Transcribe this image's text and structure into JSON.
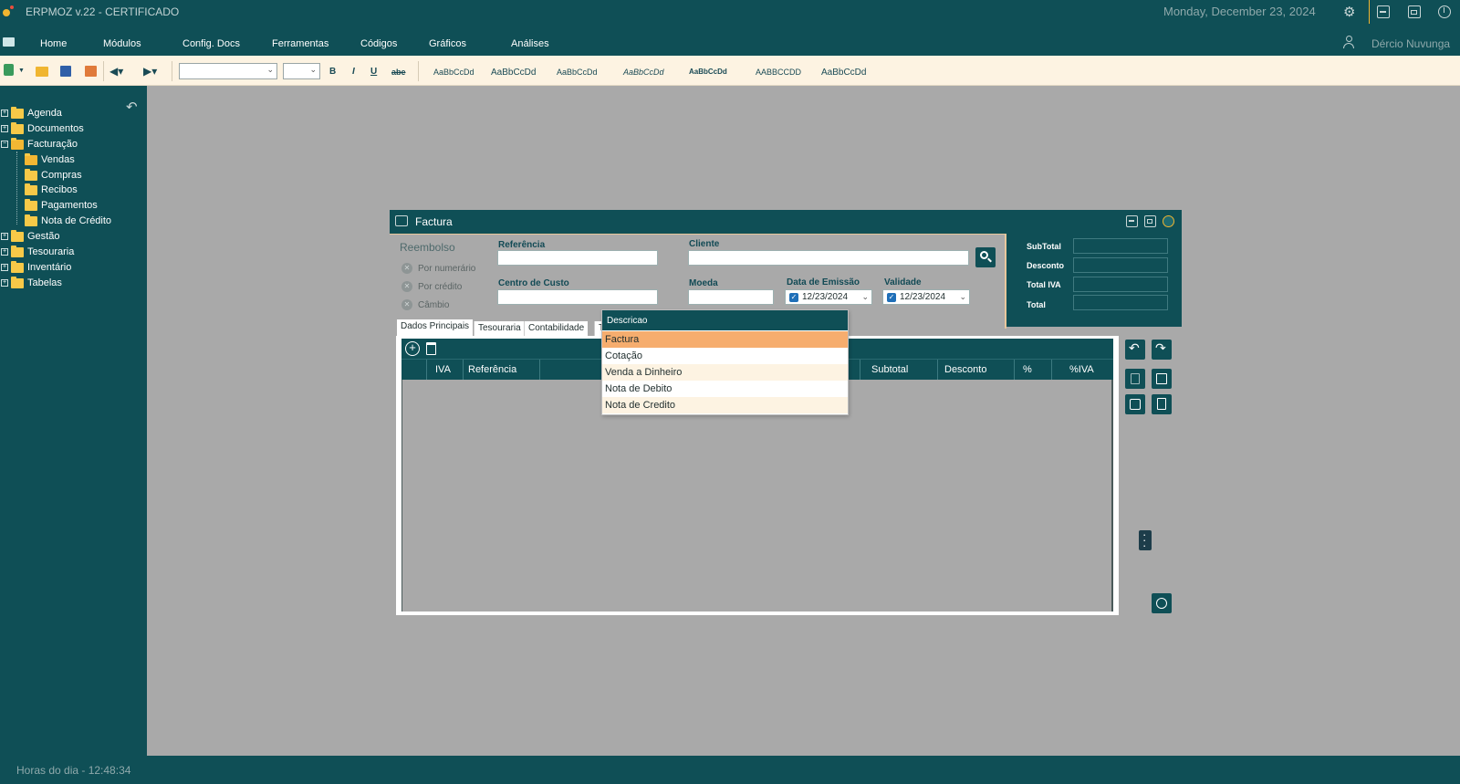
{
  "app": {
    "title": "ERPMOZ v.22 - CERTIFICADO",
    "date": "Monday, December 23, 2024",
    "user": "Dércio Nuvunga",
    "status_clock": "Horas do dia - 12:48:34"
  },
  "menu": [
    "Home",
    "Módulos",
    "Config. Docs",
    "Ferramentas",
    "Códigos",
    "Gráficos",
    "Análises"
  ],
  "toolbar": {
    "bold": "B",
    "italic": "I",
    "underline": "U",
    "strike": "abe",
    "styles": [
      "AaBbCcDd",
      "AaBbCcDd",
      "AaBbCcDd",
      "AaBbCcDd",
      "AaBbCcDd",
      "AABBCCDD",
      "AaBbCcDd"
    ]
  },
  "sidebar": {
    "items": [
      {
        "label": "Agenda",
        "level": 0,
        "expandable": true
      },
      {
        "label": "Documentos",
        "level": 0,
        "expandable": true
      },
      {
        "label": "Facturação",
        "level": 0,
        "expandable": true
      },
      {
        "label": "Vendas",
        "level": 1,
        "expandable": false
      },
      {
        "label": "Compras",
        "level": 1,
        "expandable": false
      },
      {
        "label": "Recibos",
        "level": 1,
        "expandable": false
      },
      {
        "label": "Pagamentos",
        "level": 1,
        "expandable": false
      },
      {
        "label": "Nota de Crédito",
        "level": 1,
        "expandable": false
      },
      {
        "label": "Gestão",
        "level": 0,
        "expandable": true
      },
      {
        "label": "Tesouraria",
        "level": 0,
        "expandable": true
      },
      {
        "label": "Inventário",
        "level": 0,
        "expandable": true
      },
      {
        "label": "Tabelas",
        "level": 0,
        "expandable": true
      }
    ]
  },
  "factura": {
    "title": "Factura",
    "reembolso": "Reembolso",
    "radios": [
      "Por numerário",
      "Por crédito",
      "Câmbio"
    ],
    "labels": {
      "referencia": "Referência",
      "cliente": "Cliente",
      "centro_custo": "Centro de Custo",
      "moeda": "Moeda",
      "data_emissao": "Data de Emissão",
      "validade": "Validade"
    },
    "values": {
      "referencia": "",
      "cliente": "",
      "centro_custo": "",
      "moeda": "",
      "data_emissao": "12/23/2024",
      "validade": "12/23/2024"
    },
    "totals": {
      "subtotal_label": "SubTotal",
      "desconto_label": "Desconto",
      "total_iva_label": "Total IVA",
      "total_label": "Total"
    },
    "tabs": [
      "Dados Principais",
      "Tesouraria",
      "Contabilidade",
      "T"
    ],
    "columns": [
      "IVA",
      "Referência",
      "Subtotal",
      "Desconto",
      "%",
      "%IVA"
    ]
  },
  "dropdown": {
    "header": "Descricao",
    "items": [
      "Factura",
      "Cotação",
      "Venda a Dinheiro",
      "Nota de Debito",
      "Nota de Credito"
    ],
    "selected": "Factura"
  },
  "colors": {
    "primary": "#0f4f56",
    "canvas": "#a9a9a9",
    "toolbar": "#fdf3e2",
    "highlight": "#f6ad6e",
    "folder": "#f7c948"
  }
}
